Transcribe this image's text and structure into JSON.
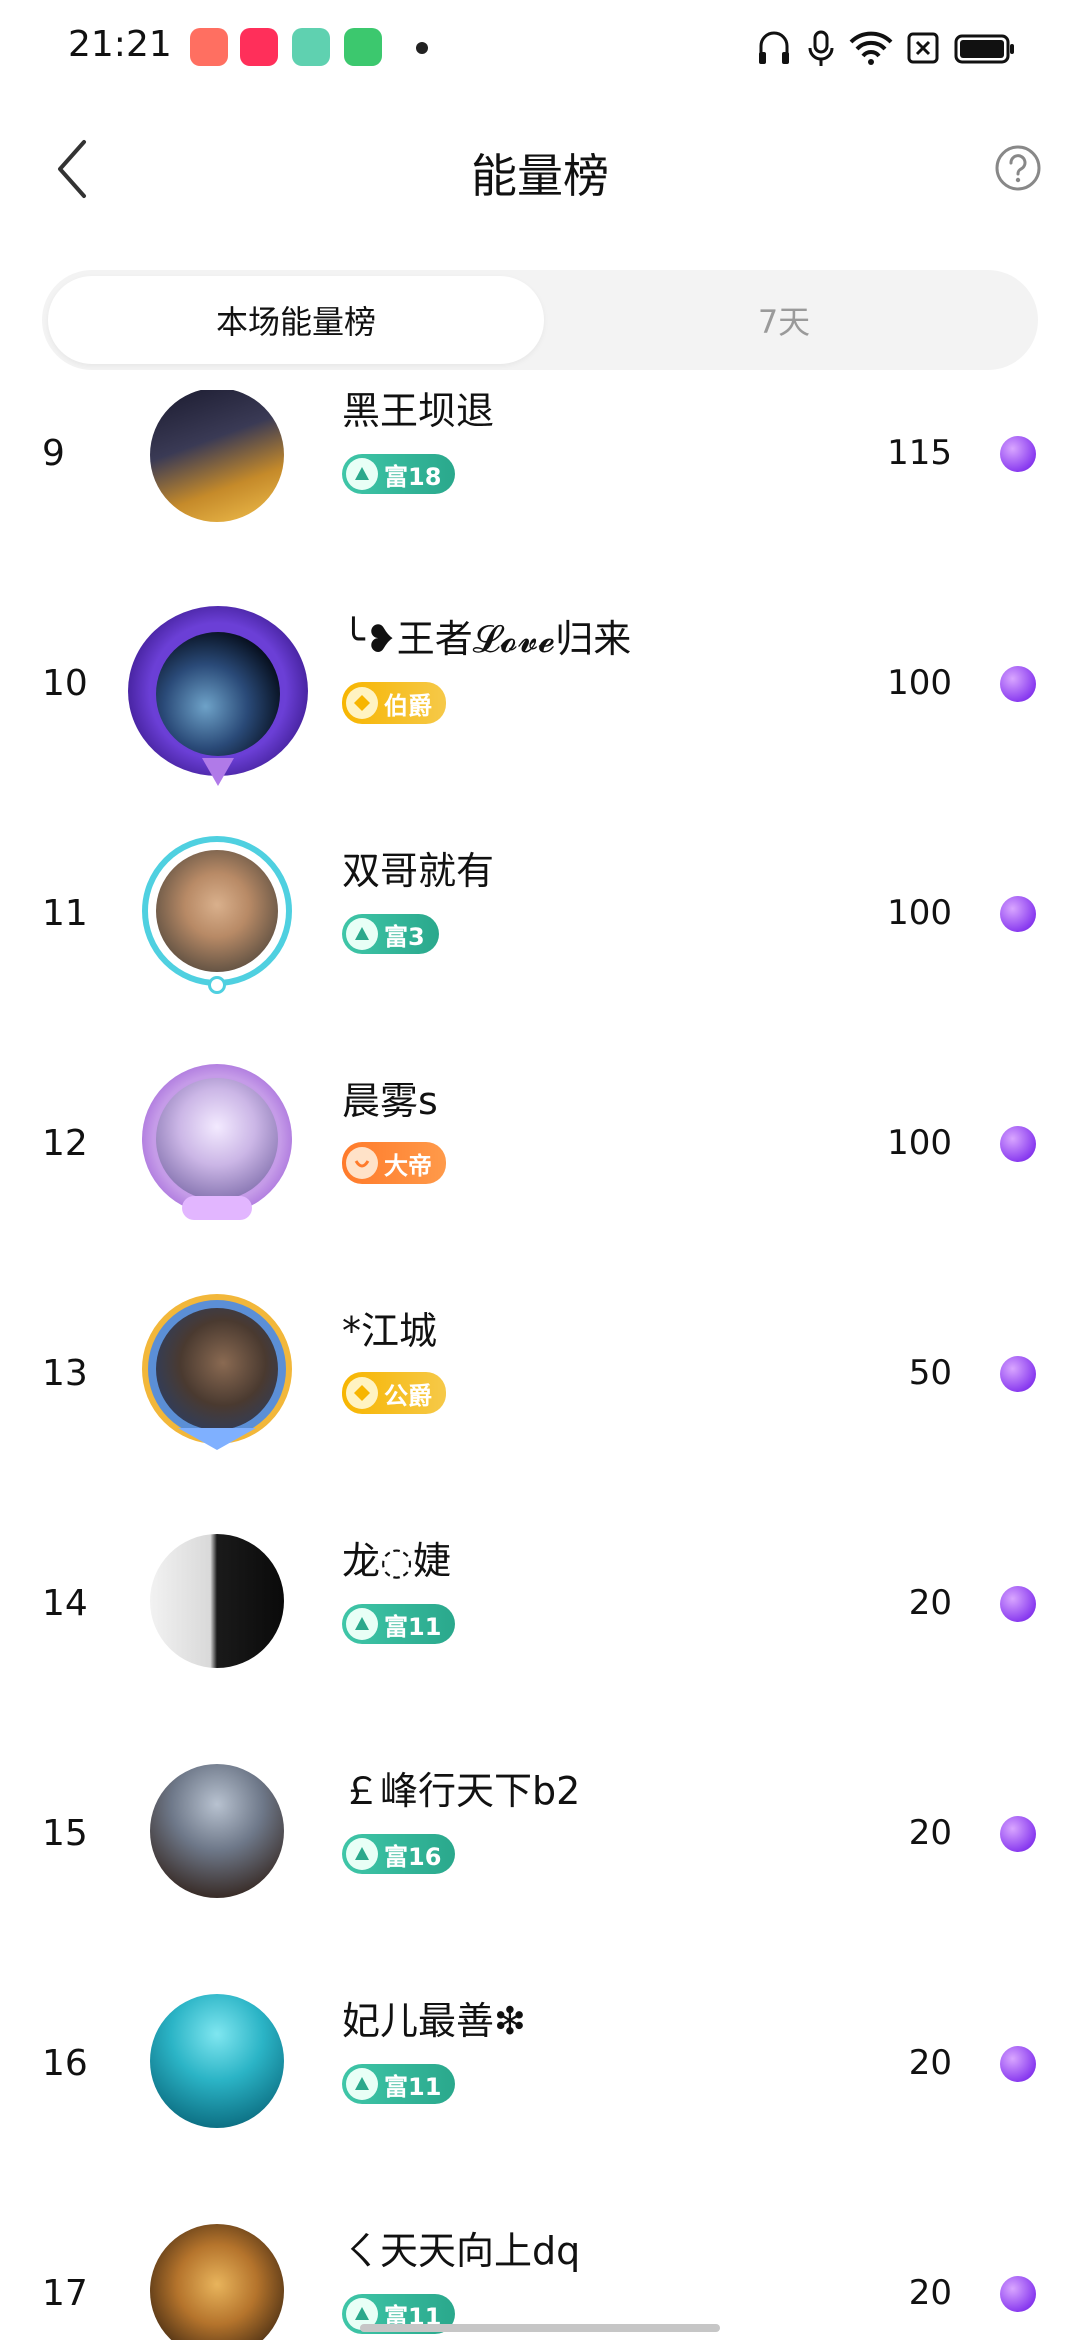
{
  "status_bar": {
    "time": "21:21"
  },
  "header": {
    "title": "能量榜"
  },
  "tabs": [
    {
      "label": "本场能量榜",
      "active": true
    },
    {
      "label": "7天",
      "active": false
    }
  ],
  "rows": [
    {
      "rank": "9",
      "name": "黑王坝退",
      "badge": "富18",
      "badge_type": "green",
      "score": "115",
      "avatar": "city-night"
    },
    {
      "rank": "10",
      "name": "╰❥王者𝓛𝓸𝓿𝓮归来",
      "badge": "伯爵",
      "badge_type": "gold",
      "score": "100",
      "avatar": "earth-frame"
    },
    {
      "rank": "11",
      "name": "双哥就有",
      "badge": "富3",
      "badge_type": "green",
      "score": "100",
      "avatar": "man-photo"
    },
    {
      "rank": "12",
      "name": "晨雾s",
      "badge": "大帝",
      "badge_type": "orange",
      "score": "100",
      "avatar": "tree-frame"
    },
    {
      "rank": "13",
      "name": "*江城",
      "badge": "公爵",
      "badge_type": "gold",
      "score": "50",
      "avatar": "warrior-frame"
    },
    {
      "rank": "14",
      "name": "龙◌婕",
      "badge": "富11",
      "badge_type": "green",
      "score": "20",
      "avatar": "bw-face"
    },
    {
      "rank": "15",
      "name": "￡峰行天下b2",
      "badge": "富16",
      "badge_type": "green",
      "score": "20",
      "avatar": "hooded-figure"
    },
    {
      "rank": "16",
      "name": "妃儿最善❇",
      "badge": "富11",
      "badge_type": "green",
      "score": "20",
      "avatar": "underwater"
    },
    {
      "rank": "17",
      "name": "ㄑ天天向上dq",
      "badge": "富11",
      "badge_type": "green",
      "score": "20",
      "avatar": "leopard"
    }
  ],
  "colors": {
    "accent_green": "#2aa88c",
    "gold": "#f7b500",
    "orange": "#ff7a2a",
    "energy": "#8a3cf0"
  }
}
